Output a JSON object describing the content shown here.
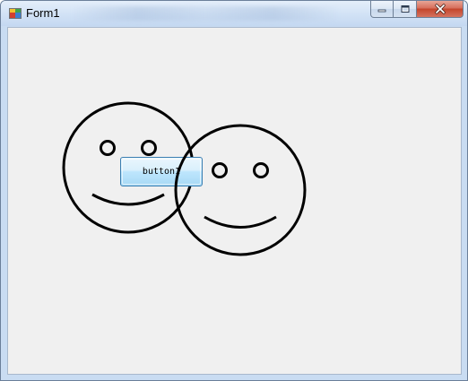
{
  "window": {
    "title": "Form1",
    "controls": {
      "minimize_icon": "minimize-icon",
      "maximize_icon": "restore-icon",
      "close_icon": "close-icon"
    }
  },
  "form": {
    "background": "#f0f0f0",
    "button1": {
      "label": "button1"
    }
  }
}
